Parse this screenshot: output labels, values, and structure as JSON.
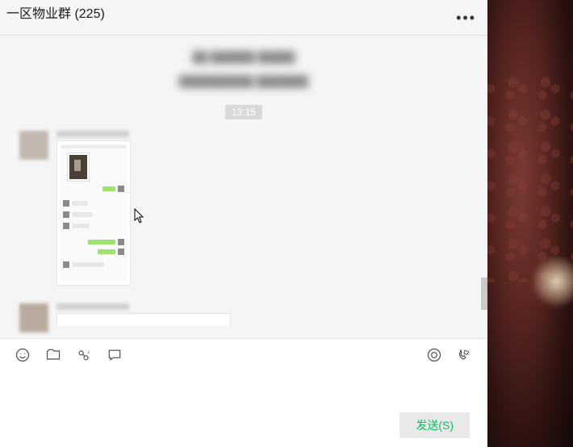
{
  "header": {
    "title": "一区物业群 (225)"
  },
  "system_messages": [
    "██ ██████ █████",
    "██████████   ███████"
  ],
  "timestamp": "13:15",
  "send_button_label": "发送(S)"
}
